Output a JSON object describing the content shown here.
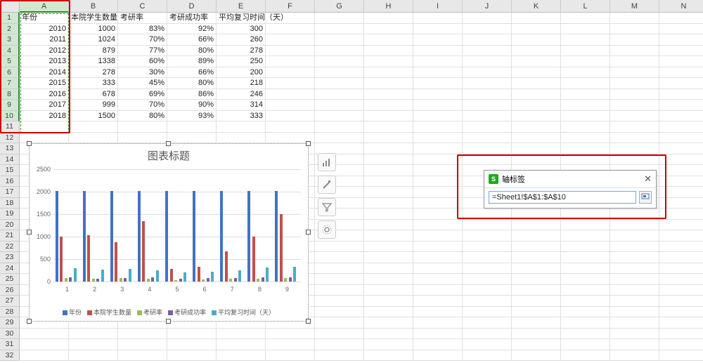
{
  "columns": [
    "A",
    "B",
    "C",
    "D",
    "E",
    "F",
    "G",
    "H",
    "I",
    "J",
    "K",
    "L",
    "M",
    "N"
  ],
  "rowCount": 32,
  "selectedCols": [
    "A"
  ],
  "selectedRows": [
    1,
    2,
    3,
    4,
    5,
    6,
    7,
    8,
    9,
    10
  ],
  "headers": {
    "A": "年份",
    "B": "本院学生数量",
    "C": "考研率",
    "D": "考研成功率",
    "E": "平均复习时间（天）"
  },
  "data": [
    {
      "A": "2010",
      "B": "1000",
      "C": "83%",
      "D": "92%",
      "E": "300"
    },
    {
      "A": "2011",
      "B": "1024",
      "C": "70%",
      "D": "66%",
      "E": "260"
    },
    {
      "A": "2012",
      "B": "879",
      "C": "77%",
      "D": "80%",
      "E": "278"
    },
    {
      "A": "2013",
      "B": "1338",
      "C": "60%",
      "D": "89%",
      "E": "250"
    },
    {
      "A": "2014",
      "B": "278",
      "C": "30%",
      "D": "66%",
      "E": "200"
    },
    {
      "A": "2015",
      "B": "333",
      "C": "45%",
      "D": "80%",
      "E": "218"
    },
    {
      "A": "2016",
      "B": "678",
      "C": "69%",
      "D": "86%",
      "E": "246"
    },
    {
      "A": "2017",
      "B": "999",
      "C": "70%",
      "D": "90%",
      "E": "314"
    },
    {
      "A": "2018",
      "B": "1500",
      "C": "80%",
      "D": "93%",
      "E": "333"
    }
  ],
  "chart_data": {
    "type": "bar",
    "title": "图表标题",
    "categories": [
      "1",
      "2",
      "3",
      "4",
      "5",
      "6",
      "7",
      "8",
      "9"
    ],
    "ylim": [
      0,
      2500
    ],
    "yticks": [
      0,
      500,
      1000,
      1500,
      2000,
      2500
    ],
    "legend": [
      "年份",
      "本院学生数量",
      "考研率",
      "考研成功率",
      "平均复习时间（天）"
    ],
    "colors": {
      "年份": "#4472c4",
      "本院学生数量": "#c0504d",
      "考研率": "#9bbb59",
      "考研成功率": "#7a5fa4",
      "平均复习时间（天）": "#4bacc6"
    },
    "series": [
      {
        "name": "年份",
        "values": [
          2010,
          2011,
          2012,
          2013,
          2014,
          2015,
          2016,
          2017,
          2018
        ]
      },
      {
        "name": "本院学生数量",
        "values": [
          1000,
          1024,
          879,
          1338,
          278,
          333,
          678,
          999,
          1500
        ]
      },
      {
        "name": "考研率",
        "values": [
          83,
          70,
          77,
          60,
          30,
          45,
          69,
          70,
          80
        ]
      },
      {
        "name": "考研成功率",
        "values": [
          92,
          66,
          80,
          89,
          66,
          80,
          86,
          90,
          93
        ]
      },
      {
        "name": "平均复习时间（天）",
        "values": [
          300,
          260,
          278,
          250,
          200,
          218,
          246,
          314,
          333
        ]
      }
    ]
  },
  "side_toolbar": [
    "chart-elements",
    "style",
    "filter",
    "settings"
  ],
  "axis_dialog": {
    "logo": "S",
    "title": "轴标签",
    "value": "=Sheet1!$A$1:$A$10"
  }
}
